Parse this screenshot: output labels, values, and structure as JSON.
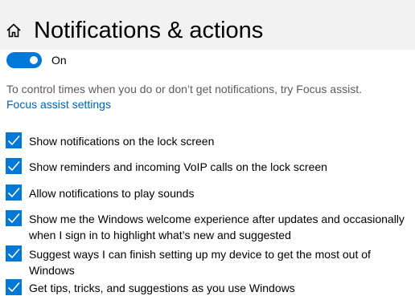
{
  "header": {
    "title": "Notifications & actions",
    "home_icon": "home-icon",
    "background": "#f2f2f2"
  },
  "notifications_toggle": {
    "state_label": "On",
    "enabled": true,
    "accent": "#0078d7"
  },
  "focus_assist": {
    "description": "To control times when you do or don’t get notifications, try Focus assist.",
    "link_label": "Focus assist settings",
    "link_color": "#0063b1"
  },
  "options": [
    {
      "label": "Show notifications on the lock screen",
      "checked": true
    },
    {
      "label": "Show reminders and incoming VoIP calls on the lock screen",
      "checked": true
    },
    {
      "label": "Allow notifications to play sounds",
      "checked": true
    },
    {
      "label": "Show me the Windows welcome experience after updates and occasionally when I sign in to highlight what’s new and suggested",
      "checked": true
    },
    {
      "label": "Suggest ways I can finish setting up my device to get the most out of Windows",
      "checked": true
    },
    {
      "label": "Get tips, tricks, and suggestions as you use Windows",
      "checked": true
    }
  ]
}
